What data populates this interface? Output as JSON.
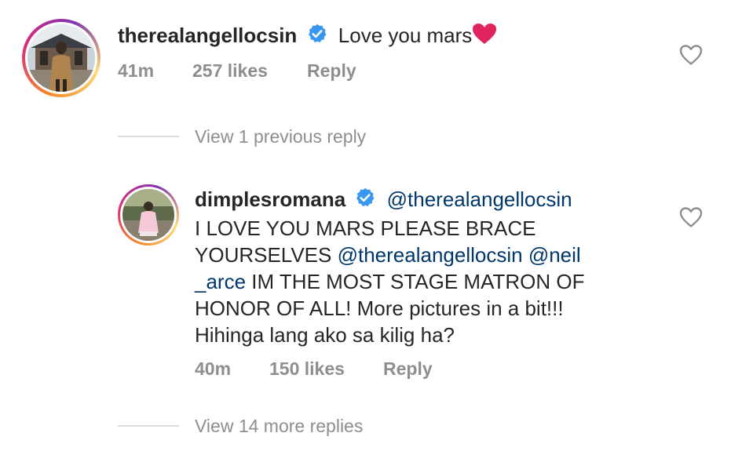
{
  "comment1": {
    "username": "therealangellocsin",
    "text": "Love you mars",
    "emoji": "❤️",
    "time": "41m",
    "likes": "257 likes",
    "reply_label": "Reply"
  },
  "view_previous": "View 1 previous reply",
  "comment2": {
    "username": "dimplesromana",
    "mention1": "@therealangellocsin",
    "line1": "I LOVE YOU MARS PLEASE BRACE",
    "line2_text": "YOURSELVES",
    "mention2": "@therealangellocsin",
    "mention3a": "@neil",
    "mention3b": "_arce",
    "line3_text": "IM THE MOST STAGE MATRON OF",
    "line4": "HONOR OF ALL! More pictures in a bit!!!",
    "line5": "Hihinga lang ako sa kilig ha?",
    "time": "40m",
    "likes": "150 likes",
    "reply_label": "Reply"
  },
  "view_more": "View 14 more replies",
  "colors": {
    "text": "#262626",
    "meta": "#8e8e8e",
    "mention": "#00376b",
    "verified": "#3897f0",
    "heart_emoji": "#e0245e"
  },
  "icons": {
    "verified": "verified-badge-icon",
    "like": "heart-outline-icon"
  }
}
